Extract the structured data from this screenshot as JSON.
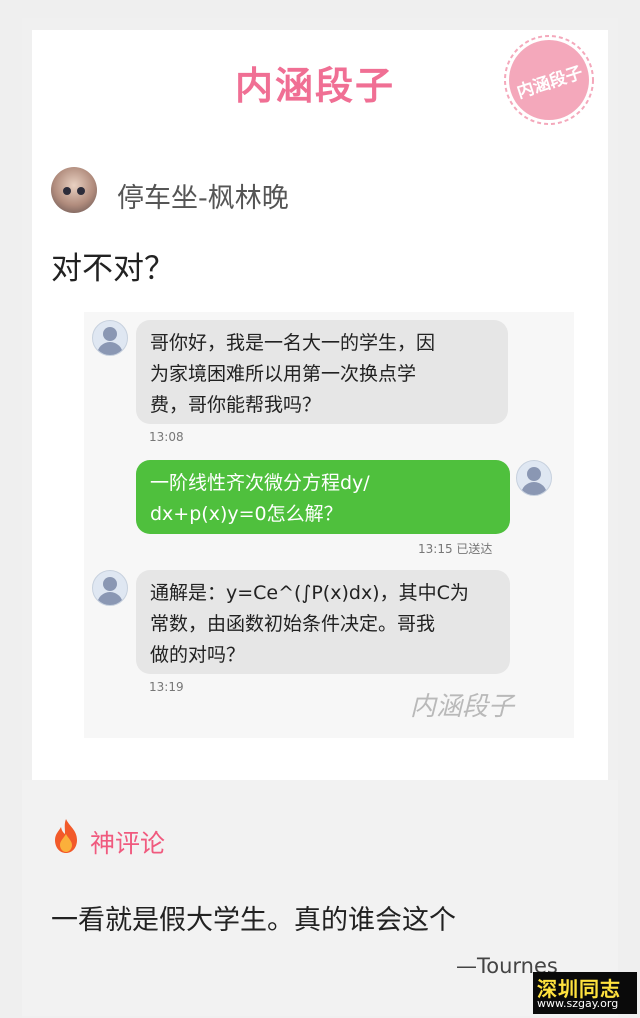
{
  "header": {
    "logo_text": "内涵段子",
    "stamp_text": "内涵段子"
  },
  "post": {
    "username": "停车坐-枫林晚",
    "text": "对不对？"
  },
  "chat": {
    "messages": [
      {
        "direction": "in",
        "lines": [
          "哥你好，我是一名大一的学生，因",
          "为家境困难所以用第一次换点学",
          "费，哥你能帮我吗？"
        ],
        "time": "13:08"
      },
      {
        "direction": "out",
        "lines": [
          "一阶线性齐次微分方程dy/",
          "dx+p(x)y=0怎么解？"
        ],
        "time": "13:15 已送达"
      },
      {
        "direction": "in",
        "lines": [
          "通解是：y=Ce^(∫P(x)dx)，其中C为",
          "常数，由函数初始条件决定。哥我",
          "做的对吗？"
        ],
        "time": "13:19"
      }
    ],
    "watermark": "内涵段子"
  },
  "comments": {
    "title": "神评论",
    "text": "一看就是假大学生。真的谁会这个",
    "author": "—Tournes"
  },
  "site_badge": {
    "title": "深圳同志",
    "url": "www.szgay.org"
  },
  "colors": {
    "brand_pink": "#f06f94",
    "sent_bubble": "#4fc03d",
    "received_bubble": "#e6e6e6"
  }
}
